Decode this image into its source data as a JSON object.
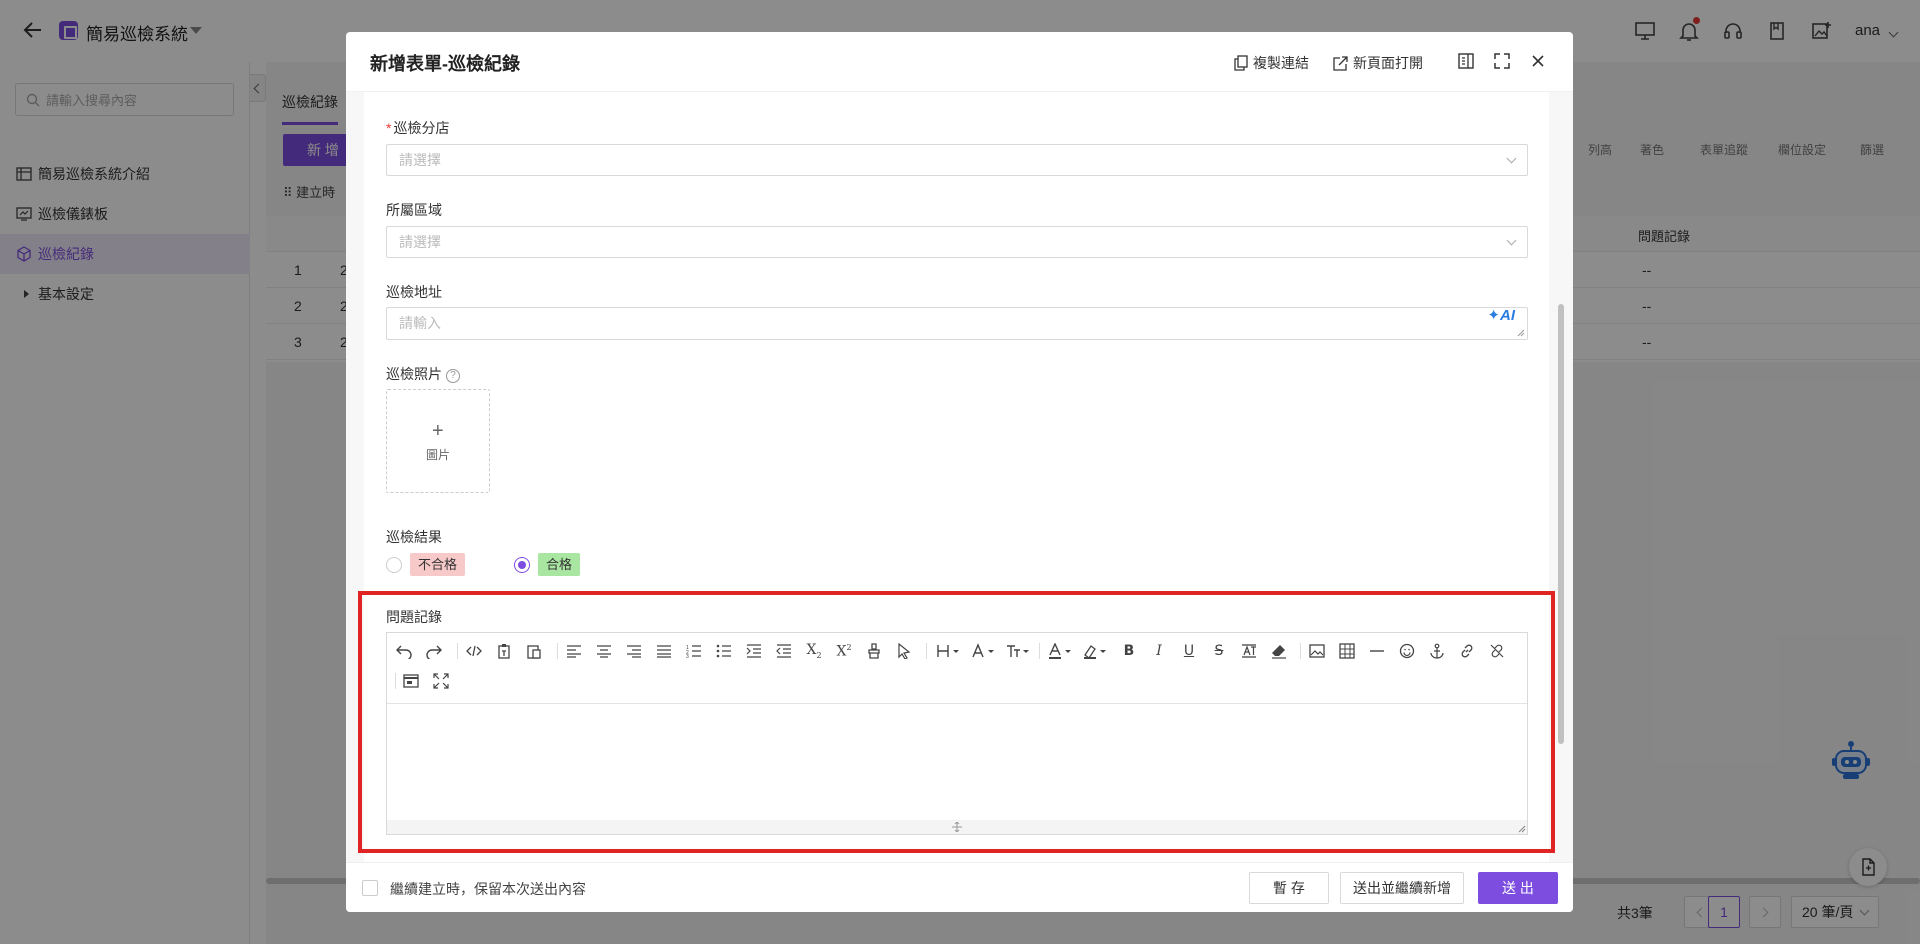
{
  "app": {
    "title": "簡易巡檢系統",
    "user": "ana"
  },
  "sidebar": {
    "search_placeholder": "請輸入搜尋內容",
    "items": [
      {
        "label": "簡易巡檢系統介紹",
        "icon": "table-icon"
      },
      {
        "label": "巡檢儀錶板",
        "icon": "dashboard-icon"
      },
      {
        "label": "巡檢紀錄",
        "icon": "cube-icon",
        "active": true
      },
      {
        "label": "基本設定",
        "icon": "caret-right-icon"
      }
    ]
  },
  "background": {
    "tab": "巡檢紀錄",
    "add_button": "新 增",
    "filter": "建立時",
    "tools": [
      "列高",
      "著色",
      "表單追蹤",
      "欄位設定",
      "篩選"
    ],
    "column_header": "問題記錄",
    "rows": [
      {
        "index": "1",
        "lead": "2",
        "value": "--"
      },
      {
        "index": "2",
        "lead": "2",
        "value": "--"
      },
      {
        "index": "3",
        "lead": "2",
        "value": "--"
      }
    ],
    "pagination": {
      "total": "共3筆",
      "current": "1",
      "page_size": "20 筆/頁"
    }
  },
  "modal": {
    "title": "新增表單-巡檢紀錄",
    "copy_link": "複製連結",
    "open_new_page": "新頁面打開",
    "fields": {
      "branch": {
        "label": "巡檢分店",
        "required": true,
        "placeholder": "請選擇"
      },
      "region": {
        "label": "所屬區域",
        "placeholder": "請選擇"
      },
      "address": {
        "label": "巡檢地址",
        "placeholder": "請輸入",
        "ai_label": "AI"
      },
      "photo": {
        "label": "巡檢照片",
        "help": "?",
        "upload_plus": "+",
        "upload_label": "圖片"
      },
      "result": {
        "label": "巡檢結果",
        "options": [
          {
            "label": "不合格",
            "color": "#f8c9c9",
            "checked": false
          },
          {
            "label": "合格",
            "color": "#a8e6a1",
            "checked": true
          }
        ]
      },
      "issue": {
        "label": "問題記錄"
      }
    },
    "footer": {
      "keep_content": "繼續建立時，保留本次送出內容",
      "save_draft": "暫 存",
      "submit_continue": "送出並繼續新增",
      "submit": "送 出"
    }
  },
  "colors": {
    "accent": "#7c4dde",
    "highlight": "#e02424"
  }
}
